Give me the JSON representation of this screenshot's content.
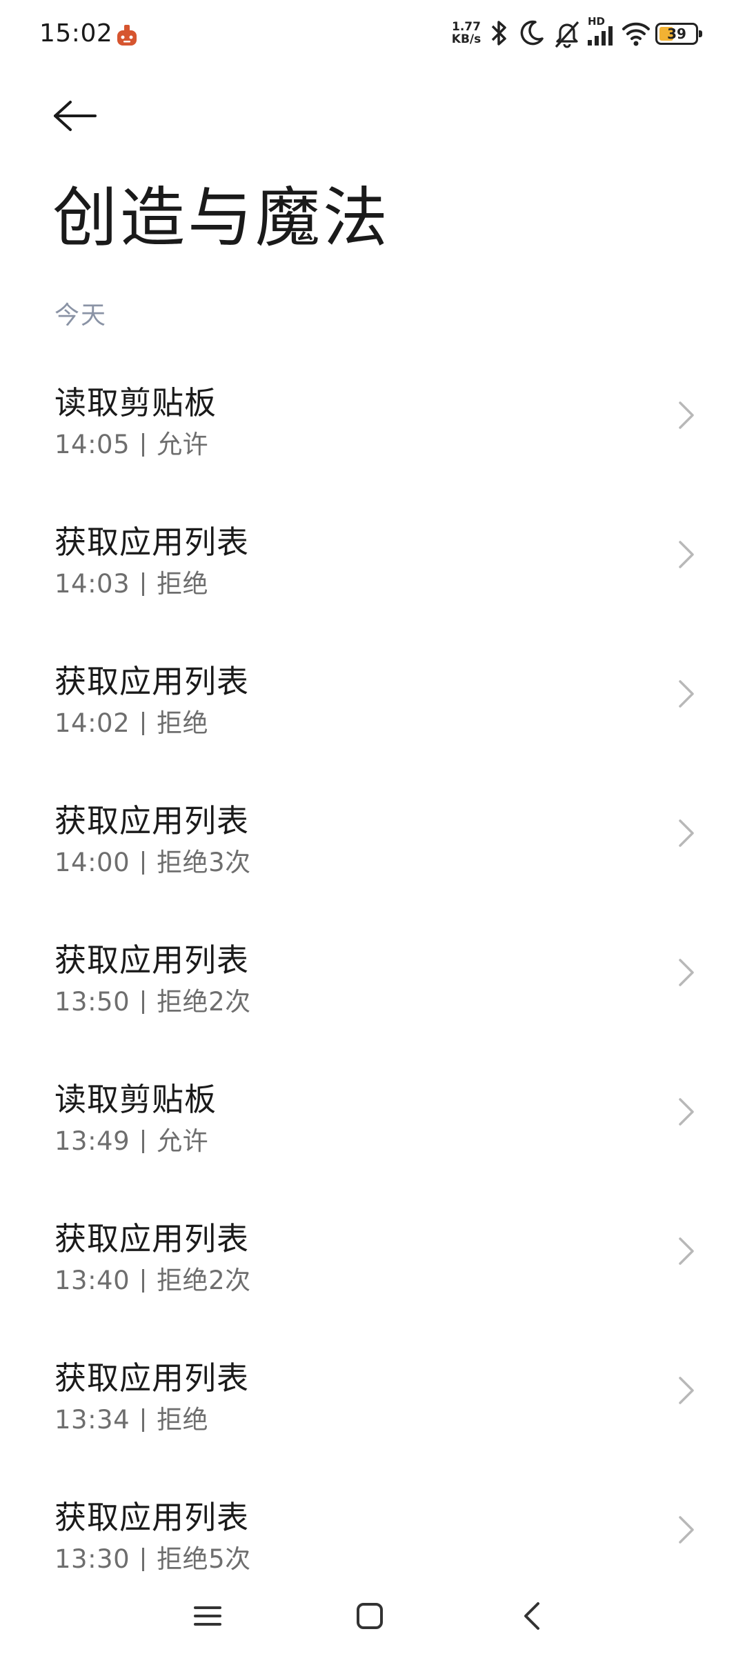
{
  "status_bar": {
    "time": "15:02",
    "net_speed_value": "1.77",
    "net_speed_unit": "KB/s",
    "signal_label": "HD",
    "battery_level": "39",
    "battery_fraction": 0.39,
    "icons": [
      "bluetooth-icon",
      "moon-icon",
      "bell-muted-icon",
      "signal-icon",
      "wifi-icon",
      "battery-icon"
    ]
  },
  "header": {
    "title": "创造与魔法"
  },
  "section": {
    "label": "今天"
  },
  "records": [
    {
      "title": "读取剪贴板",
      "time": "14:05",
      "status": "允许"
    },
    {
      "title": "获取应用列表",
      "time": "14:03",
      "status": "拒绝"
    },
    {
      "title": "获取应用列表",
      "time": "14:02",
      "status": "拒绝"
    },
    {
      "title": "获取应用列表",
      "time": "14:00",
      "status": "拒绝3次"
    },
    {
      "title": "获取应用列表",
      "time": "13:50",
      "status": "拒绝2次"
    },
    {
      "title": "读取剪贴板",
      "time": "13:49",
      "status": "允许"
    },
    {
      "title": "获取应用列表",
      "time": "13:40",
      "status": "拒绝2次"
    },
    {
      "title": "获取应用列表",
      "time": "13:34",
      "status": "拒绝"
    },
    {
      "title": "获取应用列表",
      "time": "13:30",
      "status": "拒绝5次"
    }
  ],
  "colors": {
    "section_label": "#8a93a5",
    "subtitle": "#6e6e6e",
    "chevron": "#b8b8b8",
    "battery_fill": "#f2b233"
  }
}
